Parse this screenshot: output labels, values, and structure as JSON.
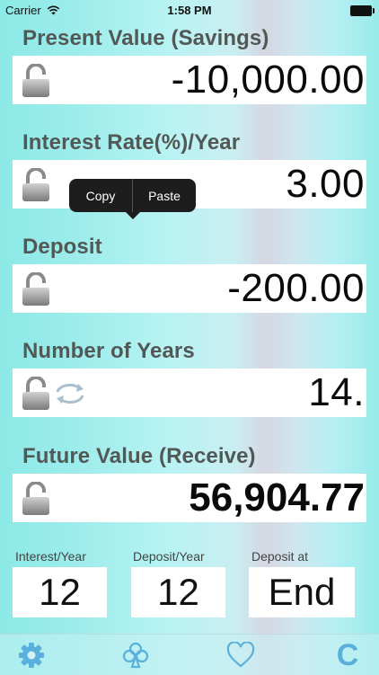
{
  "status_bar": {
    "carrier": "Carrier",
    "time": "1:58 PM"
  },
  "fields": {
    "present_value": {
      "title": "Present Value (Savings)",
      "value": "-10,000.00"
    },
    "interest_rate": {
      "title": "Interest Rate(%)/Year",
      "value": "3.00"
    },
    "deposit": {
      "title": "Deposit",
      "value": "-200.00"
    },
    "number_of_years": {
      "title": "Number of Years",
      "value": "14."
    },
    "future_value": {
      "title": "Future Value (Receive)",
      "value": "56,904.77"
    }
  },
  "popup": {
    "copy": "Copy",
    "paste": "Paste"
  },
  "options": {
    "interest_per_year": {
      "label": "Interest/Year",
      "value": "12"
    },
    "deposit_per_year": {
      "label": "Deposit/Year",
      "value": "12"
    },
    "deposit_at": {
      "label": "Deposit at",
      "value": "End"
    }
  },
  "tab_bar": {
    "icons": [
      "gear-icon",
      "club-icon",
      "heart-icon",
      "c-icon"
    ],
    "clear_label": "C",
    "accent_color": "#5ab0dc"
  }
}
